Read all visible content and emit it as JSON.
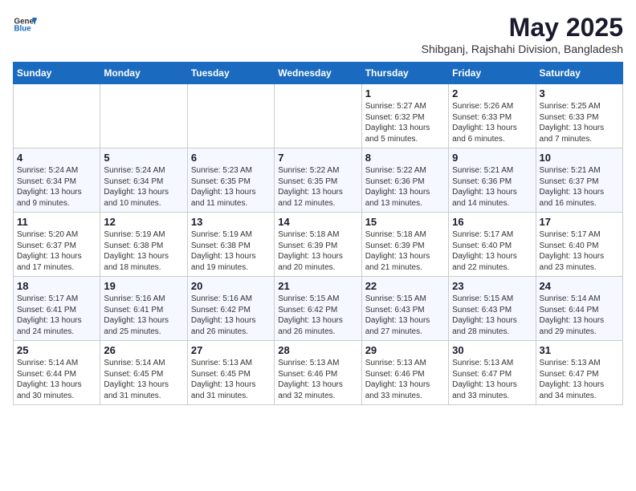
{
  "header": {
    "logo_general": "General",
    "logo_blue": "Blue",
    "month_title": "May 2025",
    "subtitle": "Shibganj, Rajshahi Division, Bangladesh"
  },
  "days_of_week": [
    "Sunday",
    "Monday",
    "Tuesday",
    "Wednesday",
    "Thursday",
    "Friday",
    "Saturday"
  ],
  "weeks": [
    [
      {
        "day": "",
        "info": ""
      },
      {
        "day": "",
        "info": ""
      },
      {
        "day": "",
        "info": ""
      },
      {
        "day": "",
        "info": ""
      },
      {
        "day": "1",
        "info": "Sunrise: 5:27 AM\nSunset: 6:32 PM\nDaylight: 13 hours\nand 5 minutes."
      },
      {
        "day": "2",
        "info": "Sunrise: 5:26 AM\nSunset: 6:33 PM\nDaylight: 13 hours\nand 6 minutes."
      },
      {
        "day": "3",
        "info": "Sunrise: 5:25 AM\nSunset: 6:33 PM\nDaylight: 13 hours\nand 7 minutes."
      }
    ],
    [
      {
        "day": "4",
        "info": "Sunrise: 5:24 AM\nSunset: 6:34 PM\nDaylight: 13 hours\nand 9 minutes."
      },
      {
        "day": "5",
        "info": "Sunrise: 5:24 AM\nSunset: 6:34 PM\nDaylight: 13 hours\nand 10 minutes."
      },
      {
        "day": "6",
        "info": "Sunrise: 5:23 AM\nSunset: 6:35 PM\nDaylight: 13 hours\nand 11 minutes."
      },
      {
        "day": "7",
        "info": "Sunrise: 5:22 AM\nSunset: 6:35 PM\nDaylight: 13 hours\nand 12 minutes."
      },
      {
        "day": "8",
        "info": "Sunrise: 5:22 AM\nSunset: 6:36 PM\nDaylight: 13 hours\nand 13 minutes."
      },
      {
        "day": "9",
        "info": "Sunrise: 5:21 AM\nSunset: 6:36 PM\nDaylight: 13 hours\nand 14 minutes."
      },
      {
        "day": "10",
        "info": "Sunrise: 5:21 AM\nSunset: 6:37 PM\nDaylight: 13 hours\nand 16 minutes."
      }
    ],
    [
      {
        "day": "11",
        "info": "Sunrise: 5:20 AM\nSunset: 6:37 PM\nDaylight: 13 hours\nand 17 minutes."
      },
      {
        "day": "12",
        "info": "Sunrise: 5:19 AM\nSunset: 6:38 PM\nDaylight: 13 hours\nand 18 minutes."
      },
      {
        "day": "13",
        "info": "Sunrise: 5:19 AM\nSunset: 6:38 PM\nDaylight: 13 hours\nand 19 minutes."
      },
      {
        "day": "14",
        "info": "Sunrise: 5:18 AM\nSunset: 6:39 PM\nDaylight: 13 hours\nand 20 minutes."
      },
      {
        "day": "15",
        "info": "Sunrise: 5:18 AM\nSunset: 6:39 PM\nDaylight: 13 hours\nand 21 minutes."
      },
      {
        "day": "16",
        "info": "Sunrise: 5:17 AM\nSunset: 6:40 PM\nDaylight: 13 hours\nand 22 minutes."
      },
      {
        "day": "17",
        "info": "Sunrise: 5:17 AM\nSunset: 6:40 PM\nDaylight: 13 hours\nand 23 minutes."
      }
    ],
    [
      {
        "day": "18",
        "info": "Sunrise: 5:17 AM\nSunset: 6:41 PM\nDaylight: 13 hours\nand 24 minutes."
      },
      {
        "day": "19",
        "info": "Sunrise: 5:16 AM\nSunset: 6:41 PM\nDaylight: 13 hours\nand 25 minutes."
      },
      {
        "day": "20",
        "info": "Sunrise: 5:16 AM\nSunset: 6:42 PM\nDaylight: 13 hours\nand 26 minutes."
      },
      {
        "day": "21",
        "info": "Sunrise: 5:15 AM\nSunset: 6:42 PM\nDaylight: 13 hours\nand 26 minutes."
      },
      {
        "day": "22",
        "info": "Sunrise: 5:15 AM\nSunset: 6:43 PM\nDaylight: 13 hours\nand 27 minutes."
      },
      {
        "day": "23",
        "info": "Sunrise: 5:15 AM\nSunset: 6:43 PM\nDaylight: 13 hours\nand 28 minutes."
      },
      {
        "day": "24",
        "info": "Sunrise: 5:14 AM\nSunset: 6:44 PM\nDaylight: 13 hours\nand 29 minutes."
      }
    ],
    [
      {
        "day": "25",
        "info": "Sunrise: 5:14 AM\nSunset: 6:44 PM\nDaylight: 13 hours\nand 30 minutes."
      },
      {
        "day": "26",
        "info": "Sunrise: 5:14 AM\nSunset: 6:45 PM\nDaylight: 13 hours\nand 31 minutes."
      },
      {
        "day": "27",
        "info": "Sunrise: 5:13 AM\nSunset: 6:45 PM\nDaylight: 13 hours\nand 31 minutes."
      },
      {
        "day": "28",
        "info": "Sunrise: 5:13 AM\nSunset: 6:46 PM\nDaylight: 13 hours\nand 32 minutes."
      },
      {
        "day": "29",
        "info": "Sunrise: 5:13 AM\nSunset: 6:46 PM\nDaylight: 13 hours\nand 33 minutes."
      },
      {
        "day": "30",
        "info": "Sunrise: 5:13 AM\nSunset: 6:47 PM\nDaylight: 13 hours\nand 33 minutes."
      },
      {
        "day": "31",
        "info": "Sunrise: 5:13 AM\nSunset: 6:47 PM\nDaylight: 13 hours\nand 34 minutes."
      }
    ]
  ]
}
